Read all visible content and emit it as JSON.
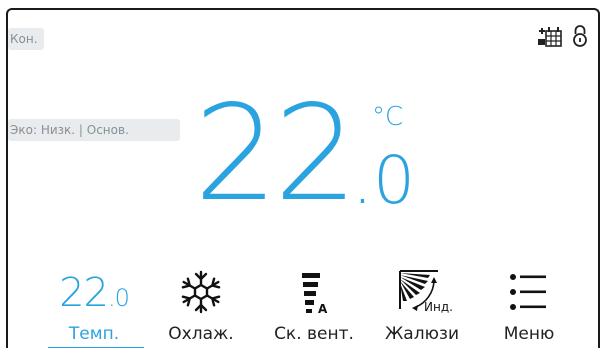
{
  "status": {
    "mode_chip": "Кон.",
    "eco_chip": "Эко: Низк. | Основ."
  },
  "temperature": {
    "integer": "22",
    "decimal": ".0",
    "unit": "°C"
  },
  "tabs": [
    {
      "label": "Темп.",
      "value_int": "22",
      "value_dec": ".0",
      "active": true
    },
    {
      "label": "Охлаж.",
      "icon": "snowflake-icon"
    },
    {
      "label": "Ск. вент.",
      "icon": "fan-speed-auto-icon",
      "icon_letter": "A"
    },
    {
      "label": "Жалюзи",
      "icon": "louver-icon",
      "icon_text": "Инд."
    },
    {
      "label": "Меню",
      "icon": "menu-list-icon"
    }
  ],
  "colors": {
    "accent": "#2ba3df",
    "chip_bg": "#e9ecee",
    "chip_text": "#8a8f93"
  }
}
